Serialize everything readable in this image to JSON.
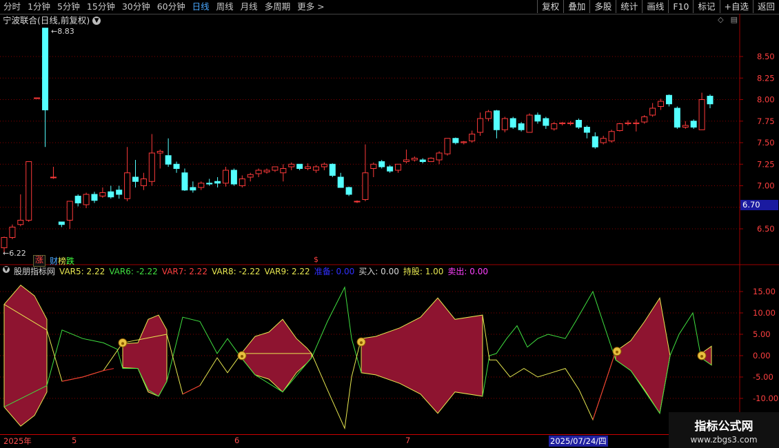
{
  "toolbar": {
    "periods": [
      {
        "label": "分时",
        "active": false
      },
      {
        "label": "1分钟",
        "active": false
      },
      {
        "label": "5分钟",
        "active": false
      },
      {
        "label": "15分钟",
        "active": false
      },
      {
        "label": "30分钟",
        "active": false
      },
      {
        "label": "60分钟",
        "active": false
      },
      {
        "label": "日线",
        "active": true
      },
      {
        "label": "周线",
        "active": false
      },
      {
        "label": "月线",
        "active": false
      },
      {
        "label": "多周期",
        "active": false
      },
      {
        "label": "更多 >",
        "active": false
      }
    ],
    "right_buttons": [
      "复权",
      "叠加",
      "多股",
      "统计",
      "画线",
      "F10",
      "标记",
      "+自选",
      "返回"
    ]
  },
  "chart_title": "宁波联合(日线,前复权)",
  "price_axis": [
    "8.50",
    "8.25",
    "8.00",
    "7.75",
    "7.50",
    "7.25",
    "7.00",
    "6.75",
    "6.50"
  ],
  "current_price": "6.70",
  "high_label": "8.83",
  "low_label": "6.22",
  "badges": {
    "zhang": "涨",
    "cai": "财",
    "bang": "榜",
    "die": "跌"
  },
  "dollar_mark": "$",
  "indicator_legend": [
    {
      "text": "股朋指标网",
      "color": "#d8d8d8"
    },
    {
      "text": "VAR5: 2.22",
      "color": "#e8e850"
    },
    {
      "text": "VAR6: -2.22",
      "color": "#40e040"
    },
    {
      "text": "VAR7: 2.22",
      "color": "#ff4040"
    },
    {
      "text": "VAR8: -2.22",
      "color": "#e8e850"
    },
    {
      "text": "VAR9: 2.22",
      "color": "#e8e850"
    },
    {
      "text": "准备: 0.00",
      "color": "#3030ff"
    },
    {
      "text": "买入: 0.00",
      "color": "#d8d8d8"
    },
    {
      "text": "持股: 1.00",
      "color": "#e8e850"
    },
    {
      "text": "卖出: 0.00",
      "color": "#ff40ff"
    }
  ],
  "indicator_axis": [
    "15.00",
    "10.00",
    "5.00",
    "0.00",
    "-5.00",
    "-10.00"
  ],
  "dates": [
    {
      "text": "2025年",
      "x": 5
    },
    {
      "text": "5",
      "x": 104
    },
    {
      "text": "6",
      "x": 340
    },
    {
      "text": "7",
      "x": 588
    }
  ],
  "cursor_date": "2025/07/24/四",
  "watermark": {
    "title": "指标公式网",
    "url": "www.zbgs3.com"
  },
  "colors": {
    "up": "#ff3a3a",
    "down": "#54ffff",
    "grid": "#8a0000",
    "fill": "#8e1430"
  },
  "chart_data": {
    "type": "candlestick",
    "ylim": [
      6.2,
      8.95
    ],
    "candles": [
      [
        6.28,
        6.4,
        6.22,
        6.41
      ],
      [
        6.4,
        6.52,
        6.38,
        6.55
      ],
      [
        6.55,
        6.6,
        6.53,
        6.9
      ],
      [
        6.6,
        7.28,
        6.58,
        7.28
      ],
      [
        8.02,
        8.02,
        8.01,
        8.02
      ],
      [
        8.83,
        7.88,
        7.45,
        8.83
      ],
      [
        7.1,
        7.1,
        7.08,
        7.22
      ],
      [
        6.58,
        6.55,
        6.52,
        6.58
      ],
      [
        6.6,
        6.82,
        6.5,
        6.82
      ],
      [
        6.88,
        6.8,
        6.76,
        6.9
      ],
      [
        6.78,
        6.9,
        6.74,
        6.92
      ],
      [
        6.9,
        6.83,
        6.8,
        6.93
      ],
      [
        6.88,
        6.92,
        6.86,
        6.98
      ],
      [
        6.93,
        6.87,
        6.85,
        7.0
      ],
      [
        6.95,
        6.9,
        6.85,
        7.0
      ],
      [
        6.85,
        7.15,
        6.82,
        7.45
      ],
      [
        7.1,
        7.05,
        6.98,
        7.3
      ],
      [
        7.0,
        7.08,
        6.95,
        7.15
      ],
      [
        7.05,
        7.38,
        7.0,
        7.6
      ],
      [
        7.38,
        7.4,
        7.2,
        7.42
      ],
      [
        7.35,
        7.25,
        7.22,
        7.55
      ],
      [
        7.25,
        7.2,
        7.15,
        7.28
      ],
      [
        7.15,
        6.95,
        6.94,
        7.2
      ],
      [
        6.98,
        6.95,
        6.92,
        7.05
      ],
      [
        6.98,
        7.03,
        6.95,
        7.05
      ],
      [
        7.03,
        7.02,
        7.0,
        7.08
      ],
      [
        7.05,
        7.03,
        6.98,
        7.1
      ],
      [
        7.03,
        7.18,
        6.99,
        7.22
      ],
      [
        7.18,
        7.02,
        7.0,
        7.2
      ],
      [
        7.0,
        7.08,
        6.98,
        7.12
      ],
      [
        7.1,
        7.13,
        7.05,
        7.15
      ],
      [
        7.14,
        7.18,
        7.1,
        7.2
      ],
      [
        7.16,
        7.18,
        7.14,
        7.2
      ],
      [
        7.18,
        7.22,
        7.16,
        7.22
      ],
      [
        7.15,
        7.2,
        7.05,
        7.25
      ],
      [
        7.22,
        7.25,
        7.18,
        7.27
      ],
      [
        7.25,
        7.2,
        7.18,
        7.25
      ],
      [
        7.2,
        7.22,
        7.18,
        7.26
      ],
      [
        7.18,
        7.22,
        7.15,
        7.24
      ],
      [
        7.22,
        7.25,
        7.18,
        7.27
      ],
      [
        7.25,
        7.12,
        7.1,
        7.26
      ],
      [
        7.1,
        6.98,
        6.98,
        7.15
      ],
      [
        6.98,
        6.9,
        6.88,
        6.99
      ],
      [
        6.82,
        6.82,
        6.8,
        6.83
      ],
      [
        6.84,
        7.15,
        6.82,
        7.48
      ],
      [
        7.2,
        7.25,
        7.1,
        7.27
      ],
      [
        7.28,
        7.22,
        7.2,
        7.3
      ],
      [
        7.22,
        7.17,
        7.15,
        7.24
      ],
      [
        7.18,
        7.25,
        7.15,
        7.25
      ],
      [
        7.28,
        7.3,
        7.26,
        7.42
      ],
      [
        7.3,
        7.32,
        7.28,
        7.34
      ],
      [
        7.3,
        7.28,
        7.26,
        7.32
      ],
      [
        7.28,
        7.32,
        7.28,
        7.33
      ],
      [
        7.3,
        7.38,
        7.25,
        7.4
      ],
      [
        7.37,
        7.55,
        7.35,
        7.55
      ],
      [
        7.55,
        7.5,
        7.48,
        7.56
      ],
      [
        7.5,
        7.51,
        7.48,
        7.52
      ],
      [
        7.52,
        7.6,
        7.5,
        7.64
      ],
      [
        7.62,
        7.78,
        7.58,
        7.85
      ],
      [
        7.78,
        7.86,
        7.75,
        7.88
      ],
      [
        7.87,
        7.65,
        7.55,
        7.88
      ],
      [
        7.65,
        7.78,
        7.62,
        7.8
      ],
      [
        7.78,
        7.68,
        7.66,
        7.8
      ],
      [
        7.72,
        7.65,
        7.63,
        7.74
      ],
      [
        7.62,
        7.82,
        7.62,
        7.84
      ],
      [
        7.82,
        7.75,
        7.72,
        7.85
      ],
      [
        7.78,
        7.7,
        7.66,
        7.8
      ],
      [
        7.66,
        7.72,
        7.64,
        7.74
      ],
      [
        7.72,
        7.73,
        7.7,
        7.74
      ],
      [
        7.72,
        7.73,
        7.7,
        7.75
      ],
      [
        7.76,
        7.68,
        7.66,
        7.78
      ],
      [
        7.68,
        7.62,
        7.55,
        7.7
      ],
      [
        7.57,
        7.45,
        7.43,
        7.62
      ],
      [
        7.5,
        7.55,
        7.48,
        7.58
      ],
      [
        7.52,
        7.63,
        7.5,
        7.65
      ],
      [
        7.64,
        7.72,
        7.63,
        7.73
      ],
      [
        7.72,
        7.73,
        7.7,
        7.76
      ],
      [
        7.72,
        7.73,
        7.63,
        7.77
      ],
      [
        7.74,
        7.8,
        7.72,
        7.82
      ],
      [
        7.82,
        7.9,
        7.8,
        7.96
      ],
      [
        7.92,
        7.98,
        7.88,
        8.01
      ],
      [
        8.05,
        7.95,
        7.92,
        8.06
      ],
      [
        7.9,
        7.68,
        7.66,
        7.92
      ],
      [
        7.68,
        7.7,
        7.66,
        7.75
      ],
      [
        7.75,
        7.68,
        7.66,
        7.77
      ],
      [
        7.65,
        8.0,
        7.65,
        8.08
      ],
      [
        8.04,
        7.95,
        7.9,
        8.06
      ]
    ]
  }
}
